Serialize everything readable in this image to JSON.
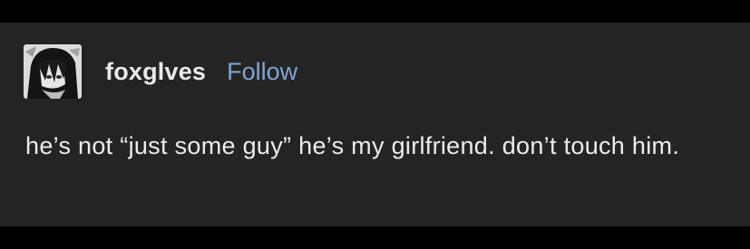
{
  "post": {
    "author": {
      "username": "foxglves",
      "avatar_icon": "anime-avatar-icon",
      "follow_label": "Follow"
    },
    "body_text": "he’s not “just some guy” he’s my girlfriend. don’t touch him."
  },
  "colors": {
    "page_background": "#000000",
    "post_background": "#242424",
    "username": "#e9e9e9",
    "follow_link": "#7fa6cf",
    "body_text": "#ececec"
  }
}
